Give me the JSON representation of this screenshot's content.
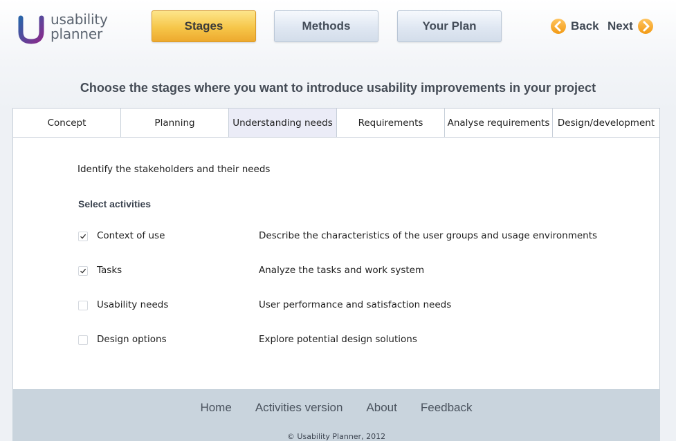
{
  "logo": {
    "line1": "usability",
    "line2": "planner",
    "mark_color_start": "#2a63a8",
    "mark_color_end": "#8a2a8c"
  },
  "nav": {
    "buttons": [
      {
        "label": "Stages",
        "active": true
      },
      {
        "label": "Methods",
        "active": false
      },
      {
        "label": "Your Plan",
        "active": false
      }
    ],
    "back_label": "Back",
    "next_label": "Next",
    "accent": "#f29a14"
  },
  "heading": "Choose the stages where you want to introduce usability improvements in your project",
  "tabs": [
    {
      "label": "Concept"
    },
    {
      "label": "Planning"
    },
    {
      "label": "Understanding needs",
      "active": true
    },
    {
      "label": "Requirements"
    },
    {
      "label": "Analyse requirements"
    },
    {
      "label": "Design/development"
    }
  ],
  "stage_intro": "Identify the stakeholders and their needs",
  "activities_label": "Select activities",
  "activities": [
    {
      "name": "Context of use",
      "description": "Describe the characteristics of the user groups and usage environments",
      "checked": true
    },
    {
      "name": "Tasks",
      "description": "Analyze the tasks and work system",
      "checked": true
    },
    {
      "name": "Usability needs",
      "description": "User performance and satisfaction needs",
      "checked": false
    },
    {
      "name": "Design options",
      "description": "Explore potential design solutions",
      "checked": false
    }
  ],
  "footer": {
    "links": [
      "Home",
      "Activities version",
      "About",
      "Feedback"
    ],
    "copyright": "© Usability Planner, 2012",
    "background": "#c9d4dd"
  }
}
